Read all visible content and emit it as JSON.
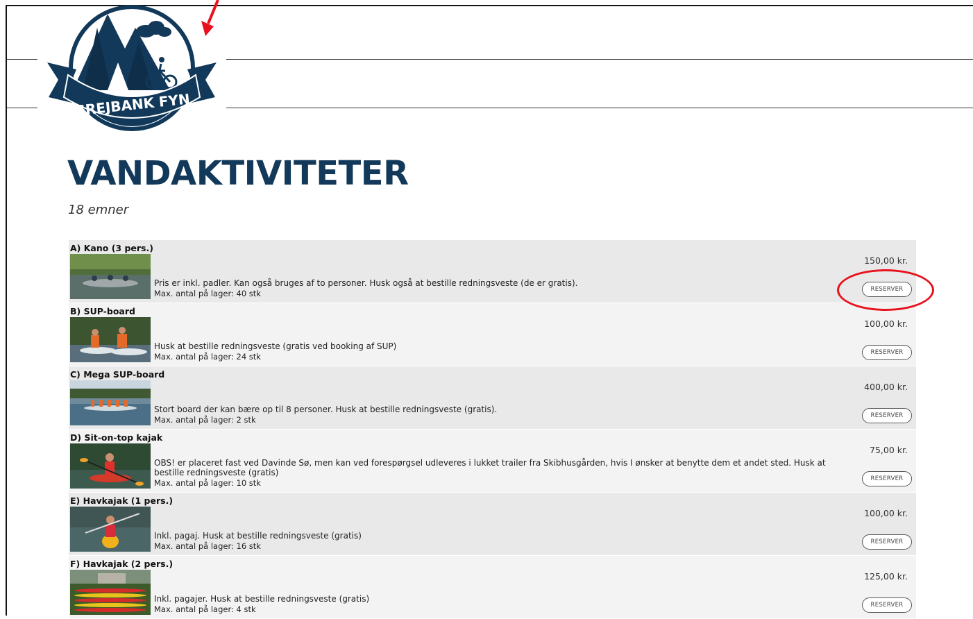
{
  "brand": {
    "name": "GREJBANK FYN",
    "colors": {
      "primary": "#12395a",
      "annotation": "#e8121d"
    }
  },
  "page": {
    "title": "VANDAKTIVITETER",
    "item_count": "18 emner"
  },
  "products": [
    {
      "name": "A) Kano (3 pers.)",
      "description": "Pris er inkl. padler. Kan også bruges af to personer. Husk også at bestille redningsveste (de er gratis).",
      "stock": "Max. antal på lager: 40 stk",
      "price": "150,00 kr.",
      "button": "RESERVER"
    },
    {
      "name": "B) SUP-board",
      "description": "Husk at bestille redningsveste (gratis ved booking af SUP)",
      "stock": "Max. antal på lager: 24 stk",
      "price": "100,00 kr.",
      "button": "RESERVER"
    },
    {
      "name": "C) Mega SUP-board",
      "description": "Stort board der kan bære op til 8 personer. Husk at bestille redningsveste (gratis).",
      "stock": "Max. antal på lager: 2 stk",
      "price": "400,00 kr.",
      "button": "RESERVER"
    },
    {
      "name": "D) Sit-on-top kajak",
      "description": "OBS! er placeret fast ved Davinde Sø, men kan ved forespørgsel udleveres i lukket trailer fra Skibhusgården, hvis I ønsker at benytte dem et andet sted. Husk at bestille redningsveste (gratis)",
      "stock": "Max. antal på lager: 10 stk",
      "price": "75,00 kr.",
      "button": "RESERVER"
    },
    {
      "name": "E) Havkajak (1 pers.)",
      "description": "Inkl. pagaj. Husk at bestille redningsveste (gratis)",
      "stock": "Max. antal på lager: 16 stk",
      "price": "100,00 kr.",
      "button": "RESERVER"
    },
    {
      "name": "F) Havkajak (2 pers.)",
      "description": "Inkl. pagajer. Husk at bestille redningsveste (gratis)",
      "stock": "Max. antal på lager: 4 stk",
      "price": "125,00 kr.",
      "button": "RESERVER"
    }
  ],
  "icons": {
    "logo": "grejbank-logo-icon",
    "annotation_arrow": "red-arrow-icon",
    "annotation_ring": "red-circle-highlight"
  }
}
